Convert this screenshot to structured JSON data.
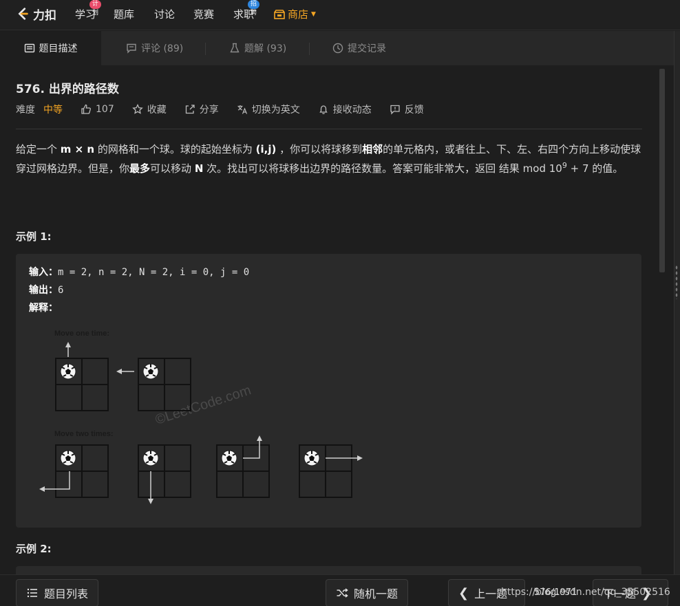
{
  "nav": {
    "logo_text": "力扣",
    "items": [
      {
        "label": "学习",
        "badge": "计划"
      },
      {
        "label": "题库"
      },
      {
        "label": "讨论"
      },
      {
        "label": "竞赛"
      },
      {
        "label": "求职",
        "badge": "招聘"
      }
    ],
    "shop_label": "商店"
  },
  "tabs": [
    {
      "label": "题目描述"
    },
    {
      "label": "评论 (89)"
    },
    {
      "label": "题解 (93)"
    },
    {
      "label": "提交记录"
    }
  ],
  "problem": {
    "title": "576. 出界的路径数",
    "difficulty_label": "难度",
    "difficulty": "中等",
    "likes": "107",
    "actions": [
      "收藏",
      "分享",
      "切换为英文",
      "接收动态",
      "反馈"
    ],
    "desc": {
      "p1": "给定一个 ",
      "b1": "m × n",
      "p2": " 的网格和一个球。球的起始坐标为 ",
      "b2": "(i,j)",
      "p3": " ，你可以将球移到",
      "b3": "相邻",
      "p4": "的单元格内，或者往上、下、左、右四个方向上移动使球穿过网格边界。但是，你",
      "b4": "最多",
      "p5": "可以移动 ",
      "b5": "N",
      "p6": " 次。找出可以将球移出边界的路径数量。答案可能非常大，返回 结果 mod 10",
      "sup": "9",
      "p7": " + 7 的值。"
    },
    "example1_title": "示例 1:",
    "example1": {
      "input_label": "输入：",
      "input_value": "m = 2, n = 2, N = 2, i = 0, j = 0",
      "output_label": "输出：",
      "output_value": "6",
      "explain_label": "解释："
    },
    "figure": {
      "label_one": "Move one time:",
      "label_two": "Move two times:",
      "watermark": "©LeetCode.com"
    },
    "example2_title": "示例 2:"
  },
  "bottom": {
    "list_label": "题目列表",
    "random_label": "随机一题",
    "prev_label": "上一题",
    "pager": "576/1971",
    "next_label": "下一题",
    "watermark": "https://blog.csdn.net/qq_35502516"
  },
  "colors": {
    "accent_orange": "#f5a623",
    "background": "#1e1e1e",
    "panel": "#2a2a2a"
  }
}
